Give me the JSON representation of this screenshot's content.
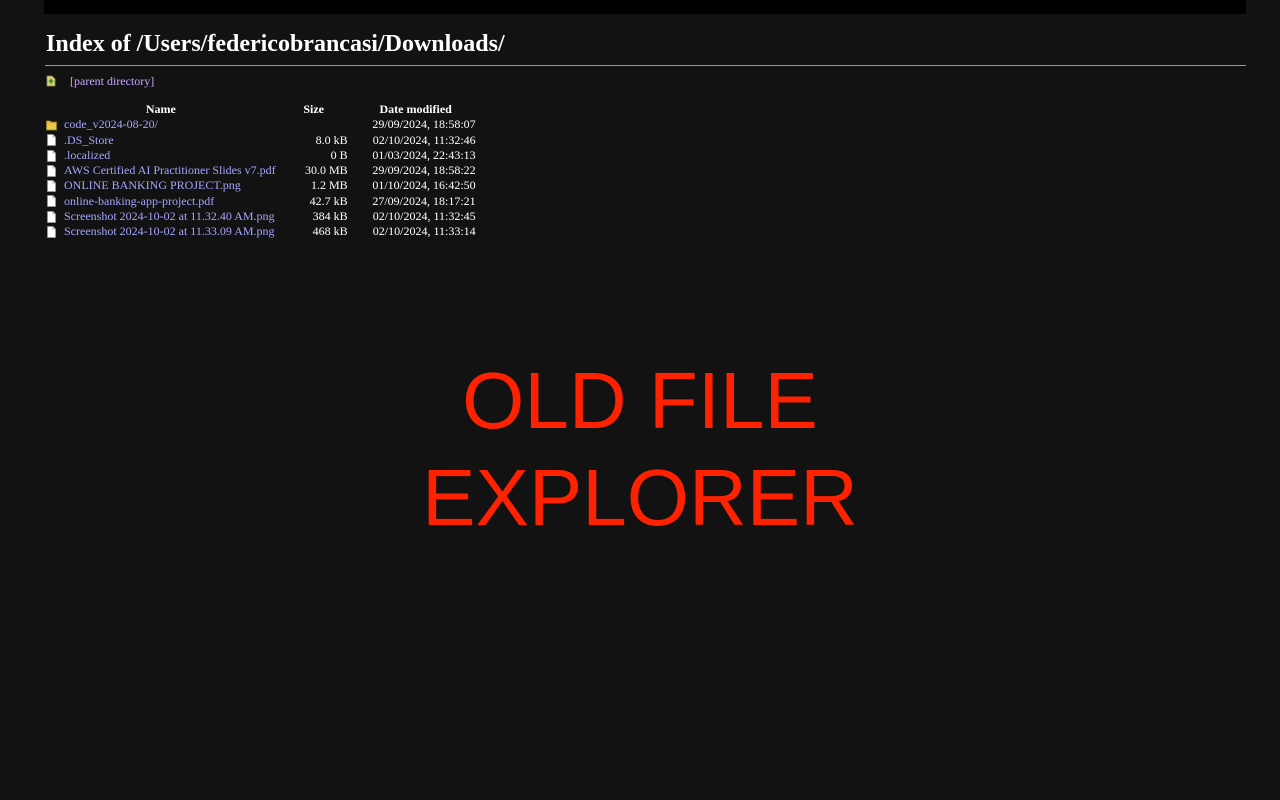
{
  "page": {
    "heading": "Index of /Users/federicobrancasi/Downloads/",
    "parent_link": "[parent directory]"
  },
  "table": {
    "headers": {
      "name": "Name",
      "size": "Size",
      "date": "Date modified"
    },
    "rows": [
      {
        "name": "code_v2024-08-20/",
        "size": "",
        "date": "29/09/2024, 18:58:07",
        "icon": "folder-icon"
      },
      {
        "name": ".DS_Store",
        "size": "8.0 kB",
        "date": "02/10/2024, 11:32:46",
        "icon": "file-icon"
      },
      {
        "name": ".localized",
        "size": "0 B",
        "date": "01/03/2024, 22:43:13",
        "icon": "file-icon"
      },
      {
        "name": "AWS Certified AI Practitioner Slides v7.pdf",
        "size": "30.0 MB",
        "date": "29/09/2024, 18:58:22",
        "icon": "file-icon"
      },
      {
        "name": "ONLINE BANKING PROJECT.png",
        "size": "1.2 MB",
        "date": "01/10/2024, 16:42:50",
        "icon": "file-icon"
      },
      {
        "name": "online-banking-app-project.pdf",
        "size": "42.7 kB",
        "date": "27/09/2024, 18:17:21",
        "icon": "file-icon"
      },
      {
        "name": "Screenshot 2024-10-02 at 11.32.40 AM.png",
        "size": "384 kB",
        "date": "02/10/2024, 11:32:45",
        "icon": "file-icon"
      },
      {
        "name": "Screenshot 2024-10-02 at 11.33.09 AM.png",
        "size": "468 kB",
        "date": "02/10/2024, 11:33:14",
        "icon": "file-icon"
      }
    ]
  },
  "overlay": {
    "line1": "OLD FILE",
    "line2": "EXPLORER"
  },
  "colors": {
    "background": "#121212",
    "link": "#a5a5ff",
    "visited_link": "#c9a6ff",
    "overlay_text": "#ff2200"
  }
}
